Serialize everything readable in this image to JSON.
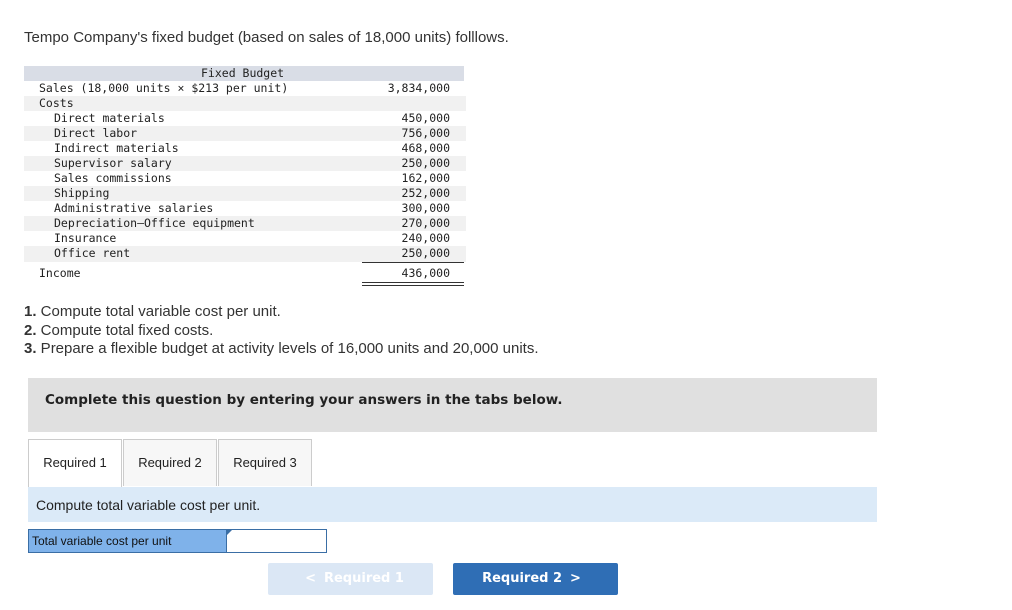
{
  "intro": "Tempo Company's fixed budget (based on sales of 18,000 units) folllows.",
  "budget": {
    "header": "Fixed Budget",
    "sales_label": "Sales (18,000 units × $213 per unit)",
    "sales_value": "3,834,000",
    "costs_label": "Costs",
    "costs": [
      {
        "label": "Direct materials",
        "value": "450,000"
      },
      {
        "label": "Direct labor",
        "value": "756,000"
      },
      {
        "label": "Indirect materials",
        "value": "468,000"
      },
      {
        "label": "Supervisor salary",
        "value": "250,000"
      },
      {
        "label": "Sales commissions",
        "value": "162,000"
      },
      {
        "label": "Shipping",
        "value": "252,000"
      },
      {
        "label": "Administrative salaries",
        "value": "300,000"
      },
      {
        "label": "Depreciation—Office equipment",
        "value": "270,000"
      },
      {
        "label": "Insurance",
        "value": "240,000"
      },
      {
        "label": "Office rent",
        "value": "250,000"
      }
    ],
    "income_label": "Income",
    "income_value": "436,000"
  },
  "requirements": [
    {
      "num": "1.",
      "text": " Compute total variable cost per unit."
    },
    {
      "num": "2.",
      "text": " Compute total fixed costs."
    },
    {
      "num": "3.",
      "text": " Prepare a flexible budget at activity levels of 16,000 units and 20,000 units."
    }
  ],
  "instruction": "Complete this question by entering your answers in the tabs below.",
  "tabs": [
    {
      "label": "Required 1",
      "active": true
    },
    {
      "label": "Required 2",
      "active": false
    },
    {
      "label": "Required 3",
      "active": false
    }
  ],
  "question": "Compute total variable cost per unit.",
  "answer": {
    "label": "Total variable cost per unit",
    "value": ""
  },
  "nav": {
    "prev_label": "Required 1",
    "next_label": "Required 2"
  },
  "colors": {
    "accent": "#2f6eb5",
    "disabled": "#dbe7f5",
    "question_bar": "#dbeaf8",
    "answer_label": "#7fb2ea"
  }
}
